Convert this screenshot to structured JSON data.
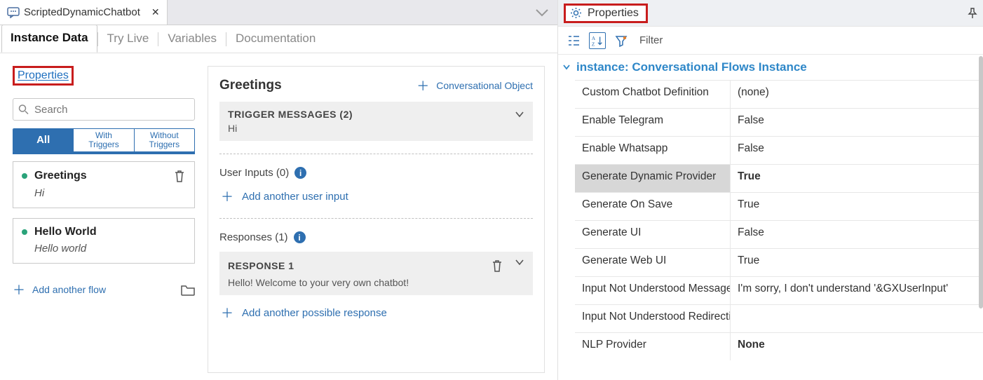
{
  "left": {
    "tab": {
      "title": "ScriptedDynamicChatbot"
    },
    "subtabs": [
      "Instance Data",
      "Try Live",
      "Variables",
      "Documentation"
    ],
    "propertiesLink": "Properties",
    "search": {
      "placeholder": "Search"
    },
    "filters": {
      "all": "All",
      "withTriggers": "With\nTriggers",
      "withoutTriggers": "Without\nTriggers"
    },
    "flows": [
      {
        "title": "Greetings",
        "subtitle": "Hi"
      },
      {
        "title": "Hello World",
        "subtitle": "Hello world"
      }
    ],
    "addFlow": "Add another flow",
    "editor": {
      "title": "Greetings",
      "convObj": "Conversational Object",
      "trigger": {
        "heading": "TRIGGER MESSAGES (2)",
        "sample": "Hi"
      },
      "userInputs": {
        "label": "User Inputs (0)",
        "add": "Add another user input"
      },
      "responses": {
        "label": "Responses (1)",
        "blockTitle": "RESPONSE 1",
        "text": "Hello! Welcome to your very own chatbot!",
        "add": "Add another possible response"
      }
    }
  },
  "right": {
    "panelTitle": "Properties",
    "filterLabel": "Filter",
    "groupTitle": "instance: Conversational Flows Instance",
    "rows": [
      {
        "name": "Custom Chatbot Definition",
        "value": "(none)"
      },
      {
        "name": "Enable Telegram",
        "value": "False"
      },
      {
        "name": "Enable Whatsapp",
        "value": "False"
      },
      {
        "name": "Generate Dynamic Provider",
        "value": "True",
        "selected": true
      },
      {
        "name": "Generate On Save",
        "value": "True"
      },
      {
        "name": "Generate UI",
        "value": "False"
      },
      {
        "name": "Generate Web UI",
        "value": "True"
      },
      {
        "name": "Input Not Understood Messages",
        "value": "I'm sorry, I don't understand '&GXUserInput'"
      },
      {
        "name": "Input Not Understood Redirection",
        "value": ""
      },
      {
        "name": "NLP Provider",
        "value": "None",
        "bold": true
      }
    ]
  }
}
